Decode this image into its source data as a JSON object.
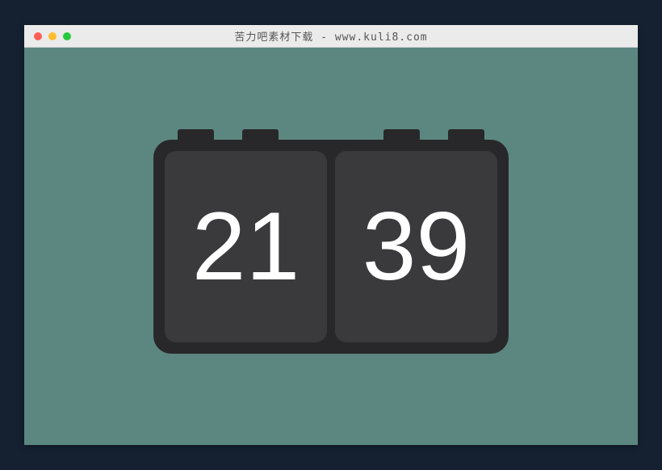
{
  "window": {
    "title": "苦力吧素材下载 - www.kuli8.com"
  },
  "clock": {
    "hours": "21",
    "minutes": "39"
  }
}
